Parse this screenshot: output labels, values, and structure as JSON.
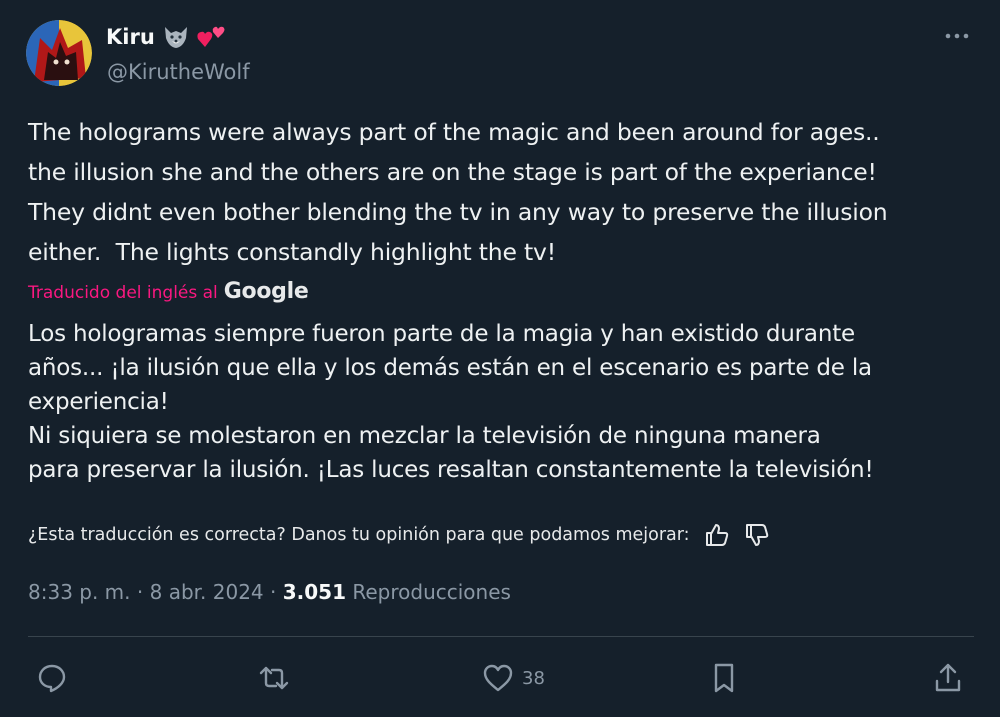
{
  "author": {
    "name": "Kiru",
    "handle": "@KirutheWolf",
    "name_emojis": [
      "wolf-face-icon",
      "two-hearts-icon"
    ]
  },
  "tweet": {
    "original_text": "The holograms were always part of the magic and been around for ages..\nthe illusion she and the others are on the stage is part of the experiance!\nThey didnt even bother blending the tv in any way to preserve the illusion\neither.  The lights constandly highlight the tv!",
    "translated_label": "Traducido del inglés al",
    "translator_brand": "Google",
    "translated_text": "Los hologramas siempre fueron parte de la magia y han existido durante\naños... ¡la ilusión que ella y los demás están en el escenario es parte de la\nexperiencia!\nNi siquiera se molestaron en mezclar la televisión de ninguna manera\npara preservar la ilusión. ¡Las luces resaltan constantemente la televisión!",
    "feedback_prompt": "¿Esta traducción es correcta? Danos tu opinión para que podamos mejorar:",
    "time": "8:33 p. m.",
    "separator": "·",
    "date": "8 abr. 2024",
    "views_count": "3.051",
    "views_label": "Reproducciones"
  },
  "actions": {
    "reply_count": "",
    "retweet_count": "",
    "like_count": "38",
    "bookmark_count": ""
  },
  "colors": {
    "background": "#15202b",
    "text": "#f7f9f9",
    "muted": "#8b98a5",
    "translated_label": "#f91880",
    "divider": "#38444d"
  }
}
